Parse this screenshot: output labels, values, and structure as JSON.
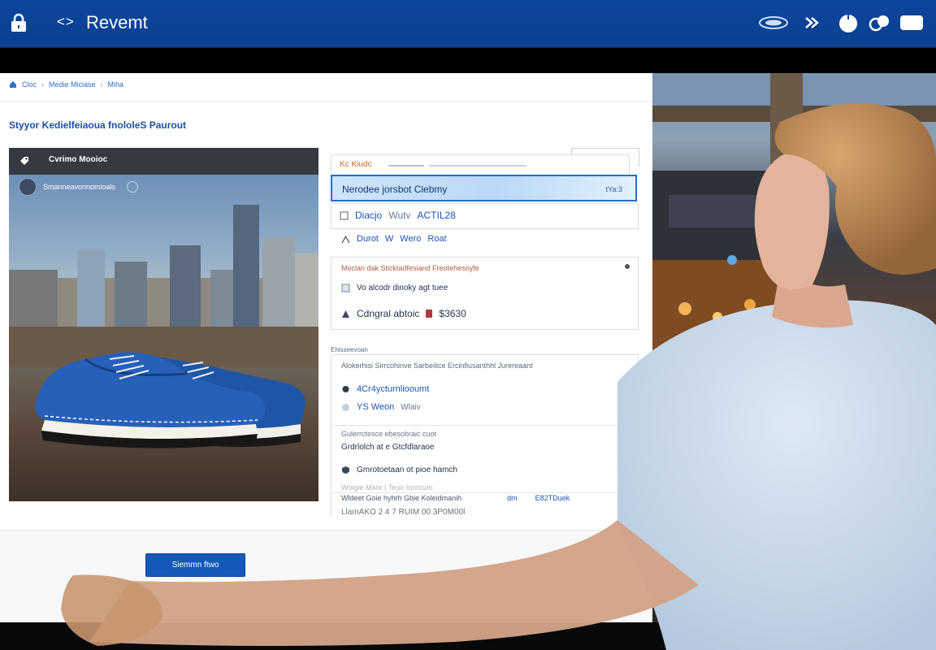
{
  "topbar": {
    "nav_arrows": "<>",
    "app_title": "Revemt",
    "icons": [
      "lock-icon",
      "cloud-badge-icon",
      "chevron-icon",
      "circle-icon",
      "shield-icon",
      "chat-icon"
    ]
  },
  "breadcrumb": [
    "Cloc",
    "Medie Miciase",
    "Miha"
  ],
  "page_title": "Styyor Kedielfeiaoua fnololeS Paurout",
  "product_card": {
    "title": "Cvrimo Mooioc",
    "subtitle": "Smanneavonnomioals"
  },
  "options": {
    "header_label": "Kc Kiudc",
    "selected_label": "Nerodee jorsbot Clebmy",
    "selected_right": "tYa:3",
    "opt2_left": "Diacjo",
    "opt2_mid": "Wutv",
    "opt2_price": "ACTIL28",
    "meta_a": "Durot",
    "meta_b": "W",
    "meta_c": "Wero",
    "meta_d": "Roat"
  },
  "details_panel": {
    "header": "Moclan dak Sticktadfesiand Freotehesoyfe",
    "line1": "Vo alcodr dinoky agt tuee",
    "line2_label": "Cdngral abtoic",
    "line2_price": "$3630"
  },
  "shipping_panel": {
    "label_top": "Ehisseevoan",
    "header": "Alokerhisi Sirrcohinve Sarbeilice Ercinfiusanthhl Jurereaant",
    "line1": "4Cr4ycturnliooumt",
    "line2_a": "YS Weon",
    "line2_b": "Wlaiv",
    "subheader": "Gulerrctesce ebesobraic cuot",
    "line3": "Grdrlolch at e Gtcfdlaraoe",
    "line4": "Gmrotoetaan ot pioe hamch"
  },
  "footnotes": {
    "l1": "Woigie Mare I Teuo Ionrcum",
    "l2": "Wldeet Goie hyhrh Gbie Koleidmanih",
    "l2_mid": "dm",
    "l2_right": "E82TDuek",
    "l3": "LlamAKO 2 4 7 RUIM 00 3P0M00l"
  },
  "submit": {
    "label": "Siemmn ftwo"
  },
  "colors": {
    "topbar": "#0b469e",
    "accent": "#1459b8",
    "selected_bg": "#bad9f7",
    "link": "#1a56b8"
  }
}
